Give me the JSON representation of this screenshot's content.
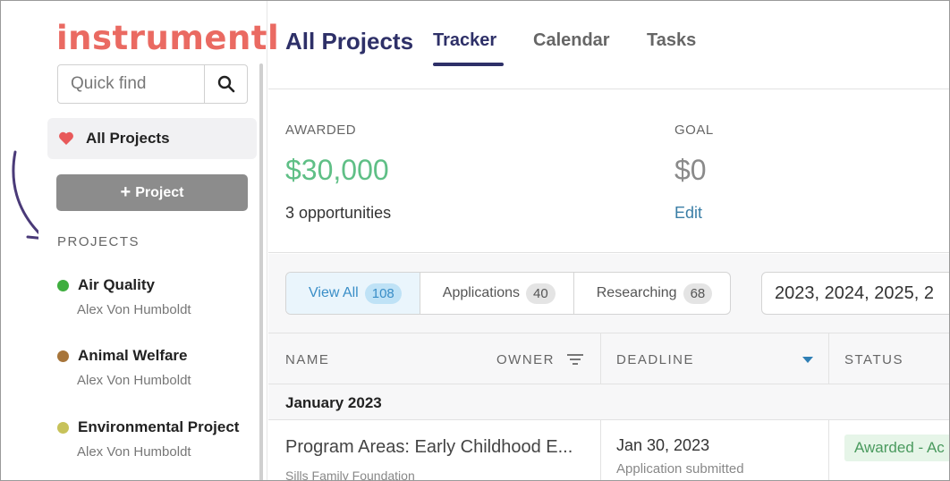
{
  "sidebar": {
    "logo": "instrumentl",
    "search": {
      "placeholder": "Quick find"
    },
    "all_projects_label": "All Projects",
    "add_project_label": "Project",
    "projects_heading": "PROJECTS",
    "projects": [
      {
        "name": "Air Quality",
        "owner": "Alex Von Humboldt",
        "color": "#3fae3f"
      },
      {
        "name": "Animal Welfare",
        "owner": "Alex Von Humboldt",
        "color": "#a7753a"
      },
      {
        "name": "Environmental Project",
        "owner": "Alex Von Humboldt",
        "color": "#c7c25a"
      }
    ]
  },
  "header": {
    "title": "All Projects",
    "tabs": [
      {
        "label": "Tracker",
        "active": true
      },
      {
        "label": "Calendar",
        "active": false
      },
      {
        "label": "Tasks",
        "active": false
      }
    ]
  },
  "summary": {
    "awarded_label": "AWARDED",
    "awarded_value": "$30,000",
    "opportunities": "3 opportunities",
    "goal_label": "GOAL",
    "goal_value": "$0",
    "edit_label": "Edit"
  },
  "filters": [
    {
      "label": "View All",
      "count": "108",
      "active": true
    },
    {
      "label": "Applications",
      "count": "40",
      "active": false
    },
    {
      "label": "Researching",
      "count": "68",
      "active": false
    }
  ],
  "year_filter": "2023, 2024, 2025, 2",
  "table": {
    "columns": {
      "name": "NAME",
      "owner": "OWNER",
      "deadline": "DEADLINE",
      "status": "STATUS"
    },
    "group": "January 2023",
    "rows": [
      {
        "name": "Program Areas: Early Childhood E...",
        "funder": "Sills Family Foundation",
        "deadline": "Jan 30, 2023",
        "deadline_note": "Application submitted",
        "status": "Awarded - Ac"
      }
    ]
  },
  "colors": {
    "logo": "#ea6a62",
    "title": "#2e3068",
    "awarded": "#5fbf86",
    "link": "#3a7ea6",
    "heart": "#e8595a"
  }
}
